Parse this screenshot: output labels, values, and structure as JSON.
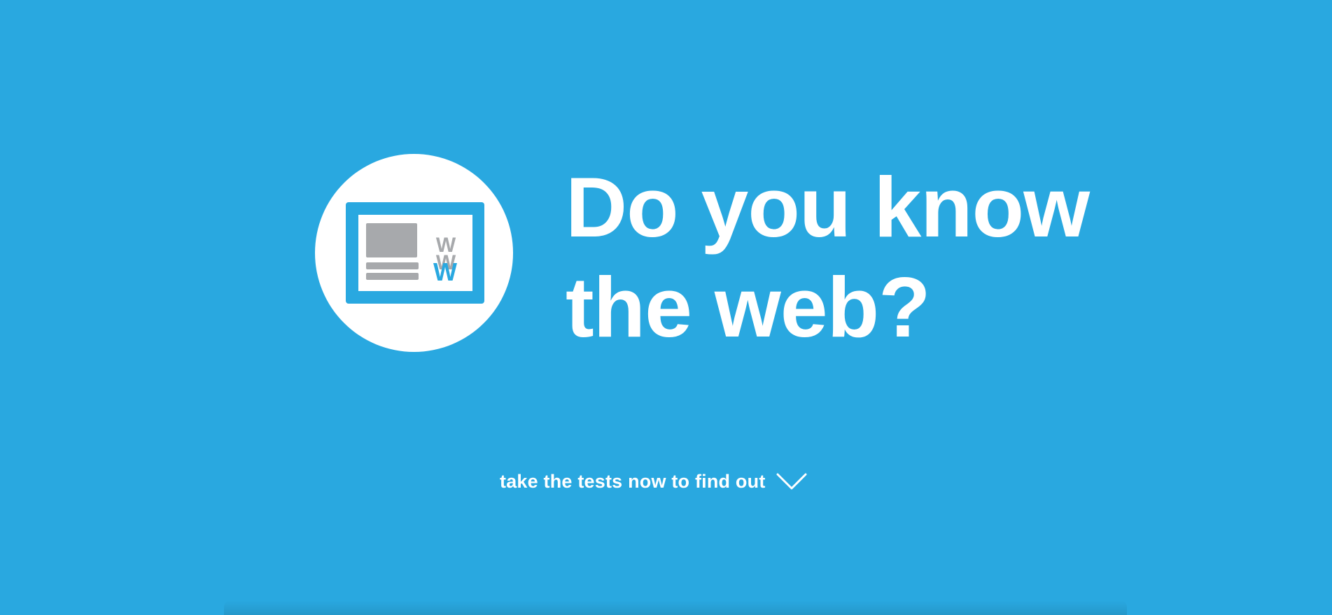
{
  "hero": {
    "headline_line1": "Do you know",
    "headline_line2": "the web?",
    "cta_label": "take the tests now to find out",
    "cta_icon": "chevron-down-icon",
    "logo_icon": "browser-window-www-icon",
    "logo_letter": "W"
  },
  "colors": {
    "background": "#29a8e0",
    "text": "#ffffff",
    "logo_grey": "#a7a9ac",
    "logo_blue": "#29a8e0"
  }
}
